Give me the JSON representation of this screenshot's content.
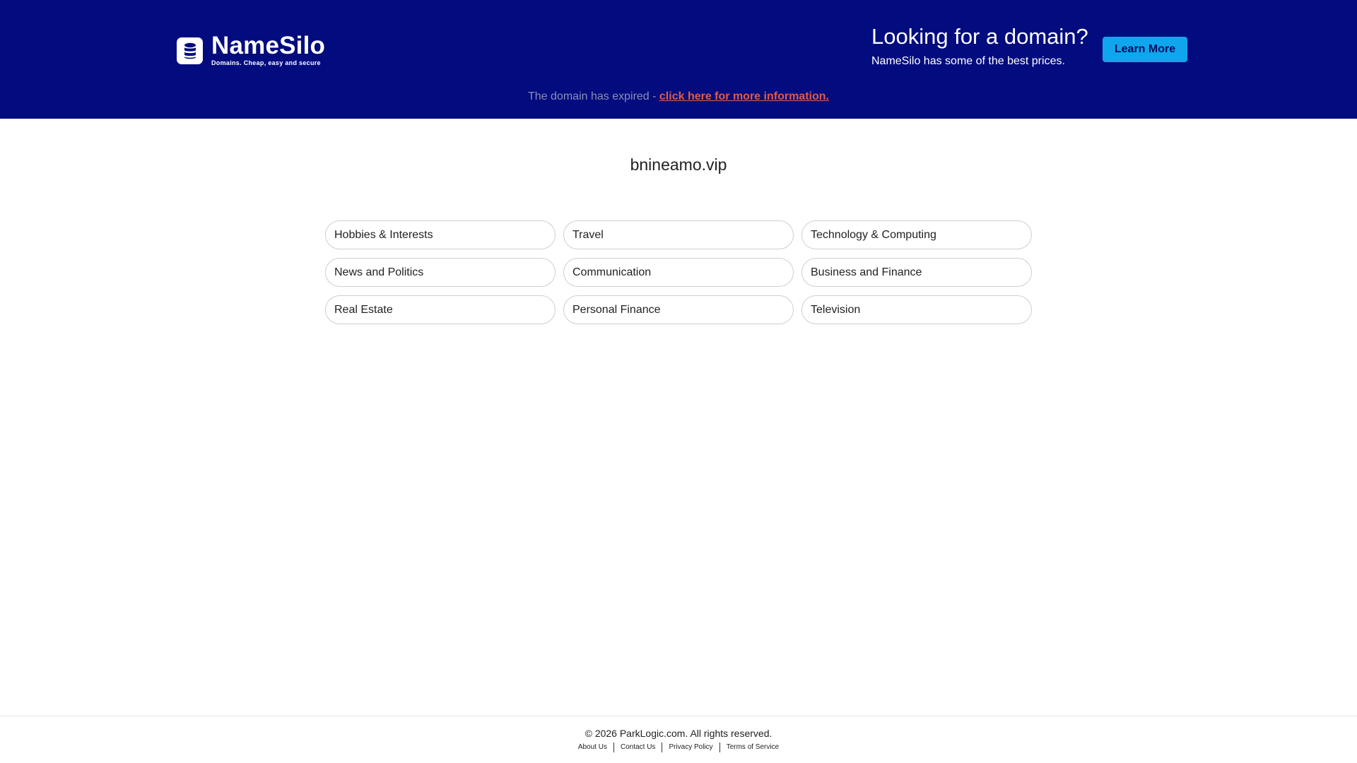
{
  "header": {
    "logo": {
      "name": "NameSilo",
      "tagline": "Domains. Cheap, easy and secure",
      "icon": "database-icon"
    },
    "promo": {
      "title": "Looking for a domain?",
      "subtitle": "NameSilo has some of the best prices.",
      "button_label": "Learn More"
    },
    "expired": {
      "text": "The domain has expired - ",
      "link_text": "click here for more information."
    }
  },
  "main": {
    "domain": "bnineamo.vip",
    "categories": [
      "Hobbies & Interests",
      "Travel",
      "Technology & Computing",
      "News and Politics",
      "Communication",
      "Business and Finance",
      "Real Estate",
      "Personal Finance",
      "Television"
    ]
  },
  "footer": {
    "copyright": "© 2026 ParkLogic.com. All rights reserved.",
    "links": [
      "About Us",
      "Contact Us",
      "Privacy Policy",
      "Terms of Service"
    ]
  },
  "colors": {
    "header_bg": "#030c7e",
    "button_bg": "#0fa6ee",
    "link_accent": "#e05b4b"
  }
}
